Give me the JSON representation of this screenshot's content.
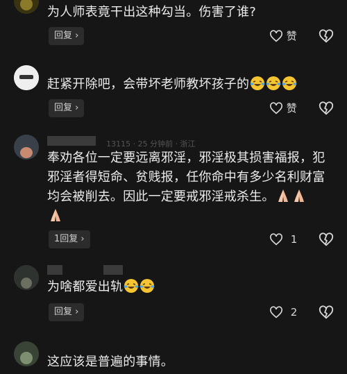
{
  "comments": [
    {
      "text": "为人师表竟干出这种勾当。伤害了谁?",
      "emoji_count": 0,
      "reply_label": "回复",
      "like_label": "赞",
      "like_count": ""
    },
    {
      "text": "赶紧开除吧，会带坏老师教坏孩子的",
      "emoji": "laughing-crying-emoji",
      "emoji_count": 3,
      "reply_label": "回复",
      "like_label": "赞",
      "like_count": ""
    },
    {
      "meta_partial": "13115 · 25 分钟前 · 浙江",
      "text_lines": [
        "奉劝各位一定要远离邪淫，邪淫极其损害福报，犯",
        "邪淫者得短命、贫贱报，任你命中有多少名利财富",
        "均会被削去。因此一定要戒邪淫戒杀生。"
      ],
      "emoji": "praying-hands-emoji",
      "emoji_count": 3,
      "reply_label": "1回复",
      "like_label": "",
      "like_count": "1"
    },
    {
      "text": "为啥都爱出轨",
      "emoji": "laughing-crying-emoji",
      "emoji_count": 2,
      "reply_label": "回复",
      "like_label": "",
      "like_count": "2"
    },
    {
      "text": "这应该是普遍的事情。"
    }
  ],
  "colors": {
    "background": "#161616",
    "reply_bg": "#2c2c2c",
    "text": "#ececec",
    "emoji_face": "#f4c531",
    "tears": "#4aa3e8",
    "hands": "#f6c7a8"
  },
  "icons": [
    "heart-outline-icon",
    "broken-heart-icon",
    "chevron-right-icon"
  ]
}
